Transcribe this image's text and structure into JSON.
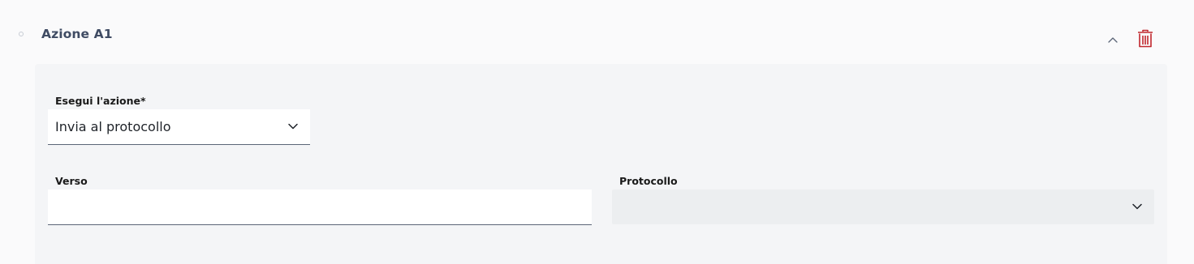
{
  "action_card": {
    "title": "Azione A1",
    "collapse_icon": "chevron-up-icon",
    "delete_icon": "trash-icon",
    "delete_color": "#c0272d"
  },
  "form": {
    "action_field": {
      "label": "Esegui l'azione*",
      "value": "Invia al protocollo"
    },
    "verso_field": {
      "label": "Verso",
      "value": ""
    },
    "protocollo_field": {
      "label": "Protocollo",
      "value": ""
    }
  }
}
